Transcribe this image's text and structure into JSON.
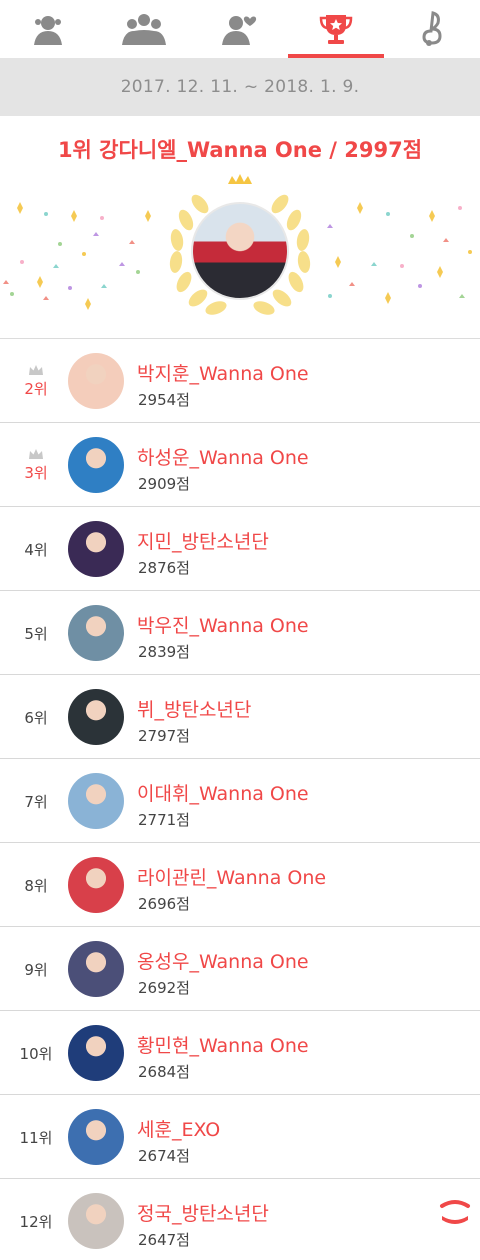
{
  "tabs": [
    {
      "icon": "single-person-icon"
    },
    {
      "icon": "group-icon"
    },
    {
      "icon": "person-heart-icon"
    },
    {
      "icon": "trophy-icon",
      "active": true
    },
    {
      "icon": "music-note-icon"
    }
  ],
  "period": "2017. 12. 11. ~ 2018. 1. 9.",
  "winner": {
    "title": "1위 강다니엘_Wanna One / 2997점"
  },
  "ranking": [
    {
      "rank": "2위",
      "name": "박지훈_Wanna One",
      "score": "2954점",
      "crown": true,
      "avatar_color": "#f4cdbb"
    },
    {
      "rank": "3위",
      "name": "하성운_Wanna One",
      "score": "2909점",
      "crown": true,
      "avatar_color": "#2f7fc4"
    },
    {
      "rank": "4위",
      "name": "지민_방탄소년단",
      "score": "2876점",
      "crown": false,
      "avatar_color": "#3a2a55"
    },
    {
      "rank": "5위",
      "name": "박우진_Wanna One",
      "score": "2839점",
      "crown": false,
      "avatar_color": "#6f8fa4"
    },
    {
      "rank": "6위",
      "name": "뷔_방탄소년단",
      "score": "2797점",
      "crown": false,
      "avatar_color": "#2b3338"
    },
    {
      "rank": "7위",
      "name": "이대휘_Wanna One",
      "score": "2771점",
      "crown": false,
      "avatar_color": "#8ab3d6"
    },
    {
      "rank": "8위",
      "name": "라이관린_Wanna One",
      "score": "2696점",
      "crown": false,
      "avatar_color": "#d8404a"
    },
    {
      "rank": "9위",
      "name": "옹성우_Wanna One",
      "score": "2692점",
      "crown": false,
      "avatar_color": "#4b4f78"
    },
    {
      "rank": "10위",
      "name": "황민현_Wanna One",
      "score": "2684점",
      "crown": false,
      "avatar_color": "#1f3d7a"
    },
    {
      "rank": "11위",
      "name": "세훈_EXO",
      "score": "2674점",
      "crown": false,
      "avatar_color": "#3d6fb0"
    },
    {
      "rank": "12위",
      "name": "정국_방탄소년단",
      "score": "2647점",
      "crown": false,
      "avatar_color": "#c9c2bd"
    }
  ],
  "colors": {
    "accent": "#f04848",
    "icon_gray": "#8a8a8a",
    "date_bar": "#e4e4e4",
    "gold": "#f5d66a"
  },
  "scroll_top_button": {
    "icon": "scroll-up-icon"
  }
}
